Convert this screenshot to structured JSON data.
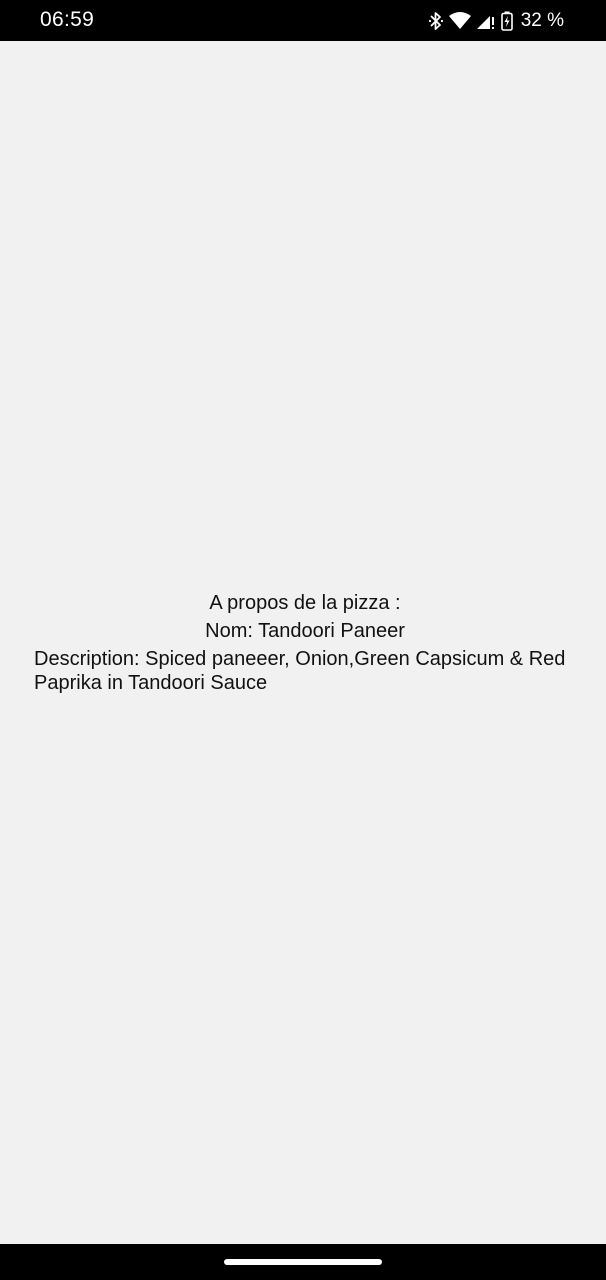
{
  "status_bar": {
    "time": "06:59",
    "battery_percent": "32 %",
    "icons": [
      "bluetooth-icon",
      "wifi-icon",
      "signal-icon",
      "battery-charging-icon"
    ]
  },
  "pizza": {
    "section_title": "A propos de la pizza :",
    "name_line": "Nom: Tandoori Paneer",
    "description_line": "Description: Spiced paneeer, Onion,Green Capsicum & Red Paprika in Tandoori Sauce"
  },
  "colors": {
    "background": "#f1f1f1",
    "bars": "#000000",
    "text": "#111111"
  }
}
